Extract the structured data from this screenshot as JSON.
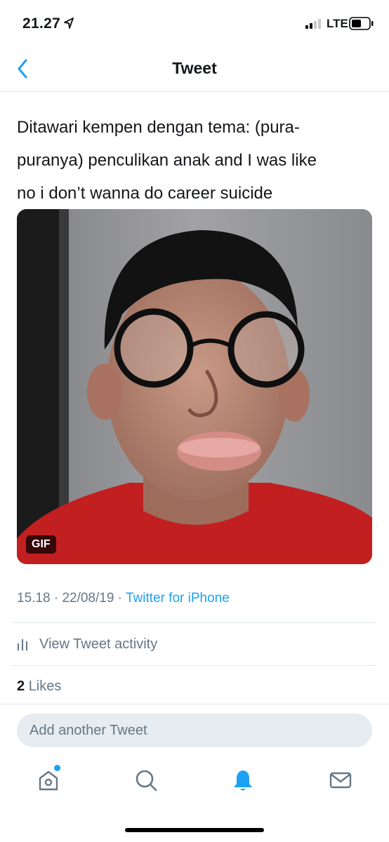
{
  "status_bar": {
    "time": "21.27",
    "network": "LTE"
  },
  "nav": {
    "title": "Tweet"
  },
  "tweet": {
    "text": "Ditawari kempen dengan tema: (pura-\npuranya) penculikan anak and I was like\nno i don’t wanna do career suicide",
    "media_badge": "GIF",
    "time": "15.18",
    "separator": " · ",
    "date": "22/08/19",
    "source": "Twitter for iPhone",
    "activity_label": "View Tweet activity",
    "likes_count": "2",
    "likes_label": "Likes"
  },
  "reply": {
    "placeholder": "Add another Tweet"
  },
  "tab_bar": {
    "tabs": [
      {
        "icon": "home-icon",
        "active": false,
        "has_dot": true
      },
      {
        "icon": "search-icon",
        "active": false
      },
      {
        "icon": "notifications-icon",
        "active": true
      },
      {
        "icon": "messages-icon",
        "active": false
      }
    ]
  },
  "colors": {
    "accent": "#1da1f2",
    "text_secondary": "#657786",
    "divider": "#e1e8ed"
  }
}
